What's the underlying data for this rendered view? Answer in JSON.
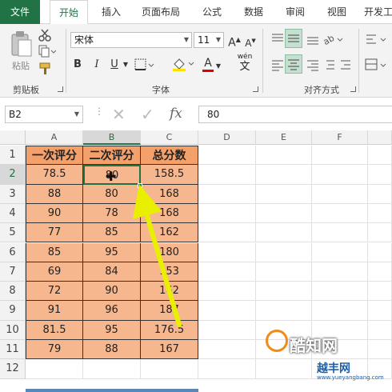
{
  "ribbon_tabs": [
    "文件",
    "开始",
    "插入",
    "页面布局",
    "公式",
    "数据",
    "审阅",
    "视图",
    "开发工"
  ],
  "clipboard": {
    "paste_label": "粘贴",
    "group_label": "剪贴板"
  },
  "font": {
    "name": "宋体",
    "size": "11",
    "group_label": "字体",
    "grow_label": "A",
    "shrink_label": "A",
    "bold": "B",
    "italic": "I",
    "underline": "U",
    "color_letter": "A",
    "wen_label": "wén",
    "wen_char": "文"
  },
  "alignment": {
    "group_label": "对齐方式"
  },
  "formula_bar": {
    "name_box": "B2",
    "fx": "fx",
    "value": "80"
  },
  "columns": [
    "A",
    "B",
    "C",
    "D",
    "E",
    "F"
  ],
  "rows": [
    "1",
    "2",
    "3",
    "4",
    "5",
    "6",
    "7",
    "8",
    "9",
    "10",
    "11",
    "12"
  ],
  "table": {
    "headers": [
      "一次评分",
      "二次评分",
      "总分数"
    ],
    "rows": [
      [
        "78.5",
        "80",
        "158.5"
      ],
      [
        "88",
        "80",
        "168"
      ],
      [
        "90",
        "78",
        "168"
      ],
      [
        "77",
        "85",
        "162"
      ],
      [
        "85",
        "95",
        "180"
      ],
      [
        "69",
        "84",
        "153"
      ],
      [
        "72",
        "90",
        "162"
      ],
      [
        "91",
        "96",
        "187"
      ],
      [
        "81.5",
        "95",
        "176.5"
      ],
      [
        "79",
        "88",
        "167"
      ]
    ]
  },
  "selected_cell": "B2",
  "watermark": {
    "site": "酷知网",
    "brand": "越丰网",
    "url": "www.yueyangbang.com"
  },
  "colors": {
    "accent": "#217346",
    "header_fill": "#f4a06a",
    "data_fill": "#f6b78f",
    "arrow": "#e8f000"
  }
}
